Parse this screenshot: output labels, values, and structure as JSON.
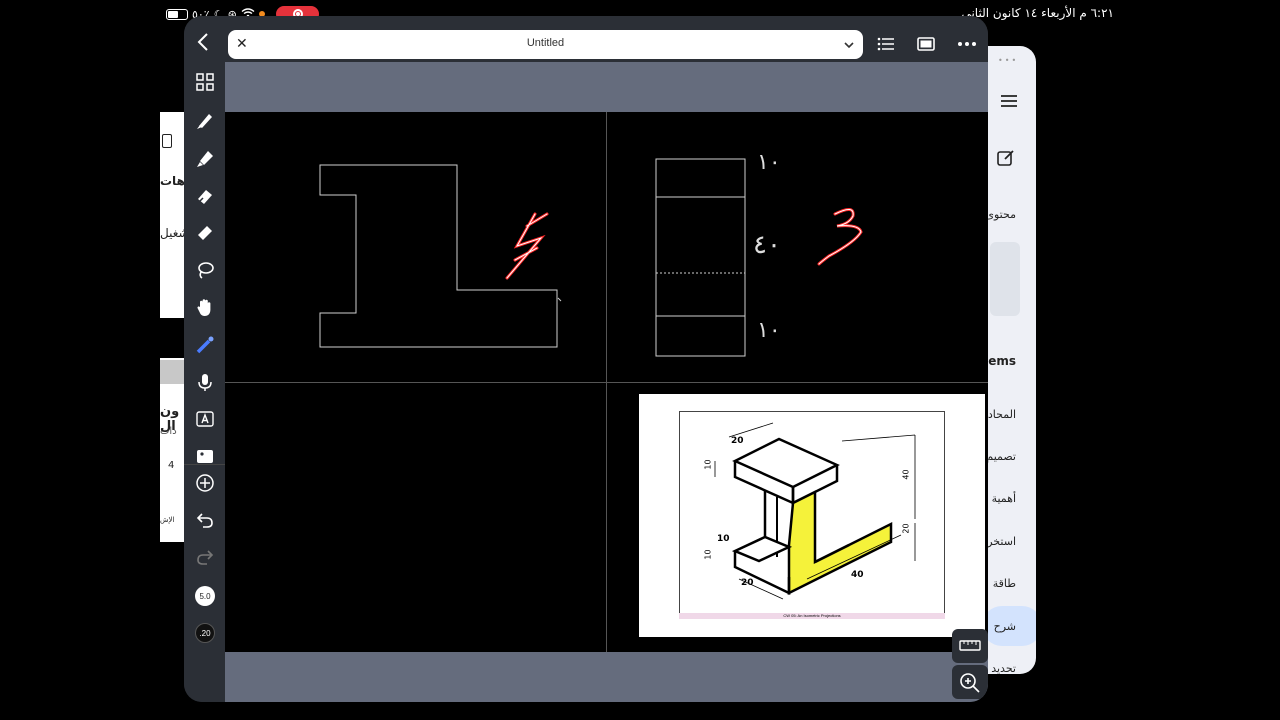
{
  "status_bar": {
    "battery": "٥٠٪",
    "time_date": "٦:٢١ م   الأربعاء ١٤ كانون الثاني"
  },
  "document": {
    "title": "Untitled"
  },
  "sidebar": {
    "stroke_size": "5.0",
    "opacity_value": ".20"
  },
  "annotations": {
    "dim_top": "١٠",
    "dim_middle": "٤٠",
    "dim_bottom": "١٠",
    "mark_red_1": "٤",
    "mark_red_2": "٣"
  },
  "reference_image": {
    "dims": [
      "20",
      "10",
      "40",
      "20",
      "10",
      "10",
      "20",
      "40"
    ],
    "caption": "CW 05: An Isometric Projections"
  },
  "background_right": {
    "items": [
      "محتوى",
      "Gems",
      "المحادثة",
      "تصميم",
      "أهمية",
      "استخر",
      "طاقة",
      "شرح",
      "تحديد"
    ]
  },
  "background_left": {
    "items": [
      "وهات",
      "شغيل",
      "ون ال",
      "دات",
      "4",
      "الإش"
    ]
  },
  "colors": {
    "app_bg": "#2b2f36",
    "canvas_bg": "#656c7d",
    "accent_red": "#e5323b",
    "highlight_yellow": "#f5f23a"
  }
}
